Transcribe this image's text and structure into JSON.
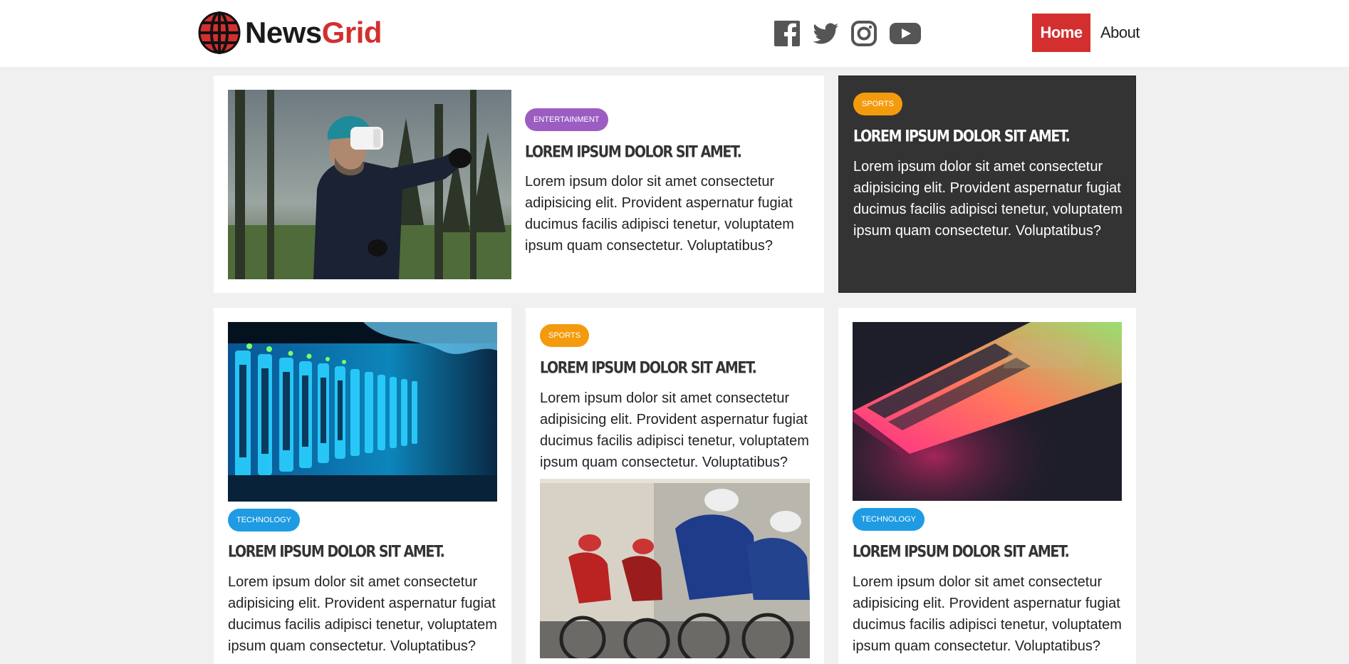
{
  "brand": {
    "name_part1": "News",
    "name_part2": "Grid",
    "accent": "#d32f2f"
  },
  "social": [
    {
      "icon": "facebook-icon"
    },
    {
      "icon": "twitter-icon"
    },
    {
      "icon": "instagram-icon"
    },
    {
      "icon": "youtube-icon"
    }
  ],
  "nav": {
    "home": "Home",
    "about": "About"
  },
  "colors": {
    "entertainment": "#9b5dc2",
    "sports": "#f49b0d",
    "technology": "#1e9be3",
    "dark_card": "#333333"
  },
  "articles": [
    {
      "category": "Entertainment",
      "title": "Lorem ipsum dolor sit amet.",
      "text": "Lorem ipsum dolor sit amet consectetur adipisicing elit. Provident aspernatur fugiat ducimus facilis adipisci tenetur, voluptatem ipsum quam consectetur. Voluptatibus?",
      "image": "vr-headset-person"
    },
    {
      "category": "Sports",
      "title": "Lorem ipsum dolor sit amet.",
      "text": "Lorem ipsum dolor sit amet consectetur adipisicing elit. Provident aspernatur fugiat ducimus facilis adipisci tenetur, voluptatem ipsum quam consectetur. Voluptatibus?"
    },
    {
      "category": "Technology",
      "title": "Lorem ipsum dolor sit amet.",
      "text": "Lorem ipsum dolor sit amet consectetur adipisicing elit. Provident aspernatur fugiat ducimus facilis adipisci tenetur, voluptatem ipsum quam consectetur. Voluptatibus?",
      "image": "server-rack"
    },
    {
      "category": "Sports",
      "title": "Lorem ipsum dolor sit amet.",
      "text": "Lorem ipsum dolor sit amet consectetur adipisicing elit. Provident aspernatur fugiat ducimus facilis adipisci tenetur, voluptatem ipsum quam consectetur. Voluptatibus?",
      "image": "cyclists-race"
    },
    {
      "category": "Technology",
      "title": "Lorem ipsum dolor sit amet.",
      "text": "Lorem ipsum dolor sit amet consectetur adipisicing elit. Provident aspernatur fugiat ducimus facilis adipisci tenetur, voluptatem ipsum quam consectetur. Voluptatibus?",
      "image": "laptop-keyboard"
    }
  ]
}
